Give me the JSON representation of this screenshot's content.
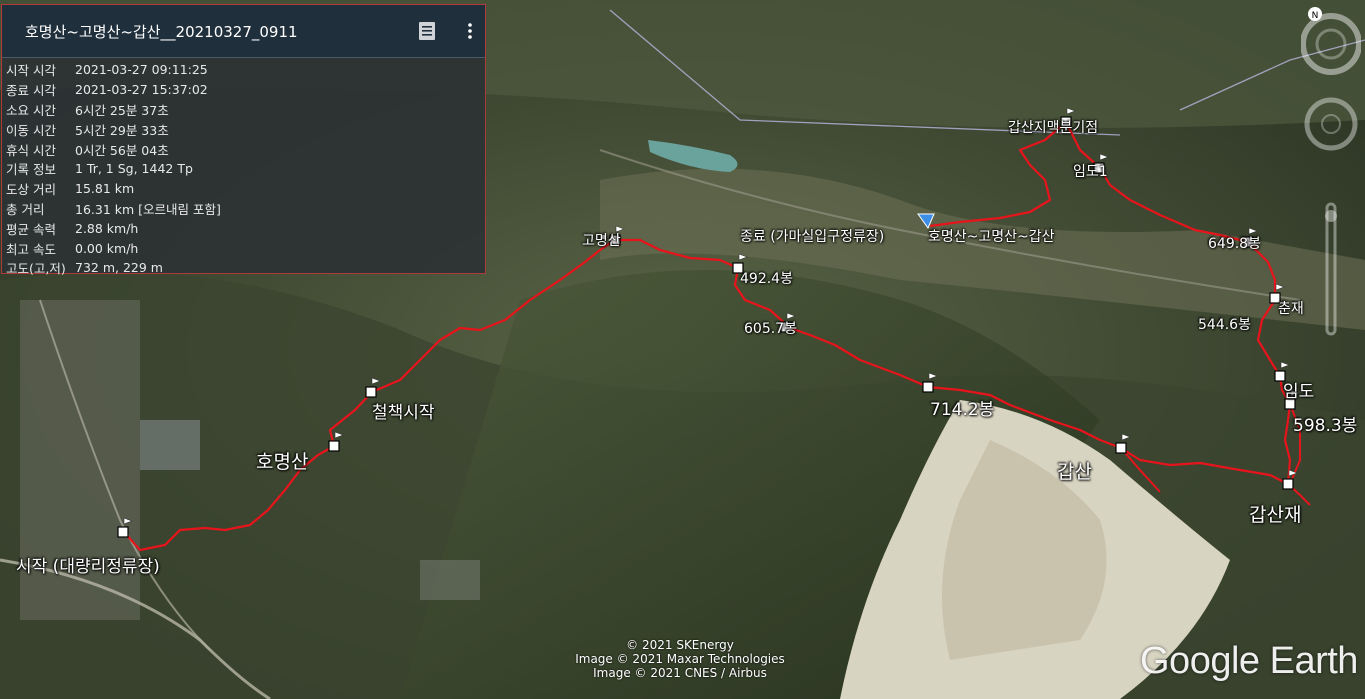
{
  "panel": {
    "title": "호명산~고명산~갑산__20210327_0911",
    "rows": [
      {
        "key": "시작 시각",
        "value": "2021-03-27 09:11:25"
      },
      {
        "key": "종료 시각",
        "value": "2021-03-27 15:37:02"
      },
      {
        "key": "소요 시간",
        "value": "6시간 25분 37초"
      },
      {
        "key": "이동 시간",
        "value": "5시간 29분 33초"
      },
      {
        "key": "휴식 시간",
        "value": "0시간 56분 04초"
      },
      {
        "key": "기록 정보",
        "value": "1 Tr, 1 Sg, 1442 Tp"
      },
      {
        "key": "도상 거리",
        "value": "15.81 km"
      },
      {
        "key": "총 거리",
        "value": "16.31 km [오르내림 포함]"
      },
      {
        "key": "평균 속력",
        "value": "2.88 km/h"
      },
      {
        "key": "최고 속도",
        "value": "0.00 km/h"
      },
      {
        "key": "고도(고,저)",
        "value": "732 m, 229 m"
      }
    ],
    "icons": {
      "list": "list-icon",
      "more": "more-vert-icon"
    }
  },
  "map": {
    "labels": {
      "start": "시작 (대량리정류장)",
      "homyeongsan": "호명산",
      "chulchaek": "철책시작",
      "gomyeongsan": "고명산",
      "p4924": "492.4봉",
      "p6057": "605.7봉",
      "end": "종료 (가마실입구정류장)",
      "track_name": "호명산~고명산~갑산",
      "gapsan_branch": "갑산지맥분기점",
      "imdo1": "임도1",
      "p6498": "649.8봉",
      "chunjae": "춘재",
      "p5446": "544.6봉",
      "imdo": "임도",
      "p5983": "598.3봉",
      "p7142": "714.2봉",
      "gapsan": "갑산",
      "gapsanjae": "갑산재"
    },
    "track_color": "#e8141b",
    "copyright": [
      "© 2021 SKEnergy",
      "Image © 2021 Maxar Technologies",
      "Image © 2021 CNES / Airbus"
    ],
    "logo": "Google Earth",
    "compass": "N"
  }
}
